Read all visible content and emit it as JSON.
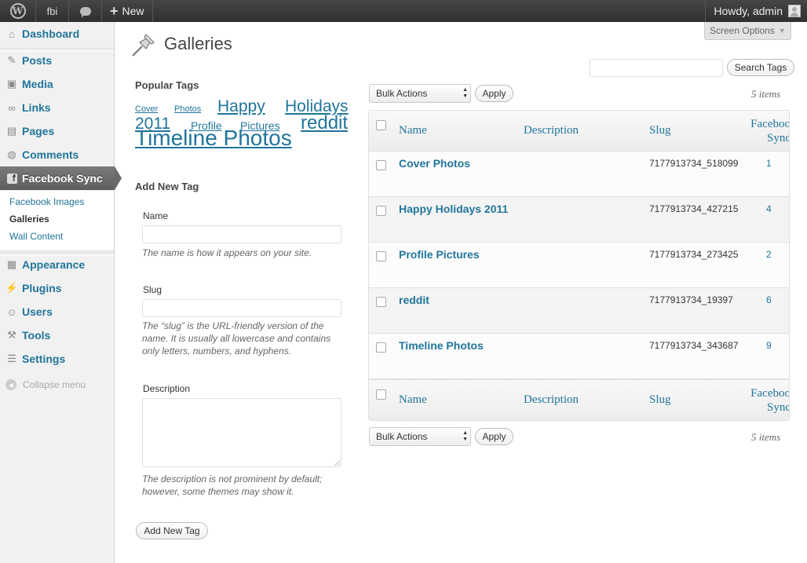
{
  "admin_bar": {
    "site_name": "fbi",
    "new_label": "New",
    "howdy": "Howdy, admin"
  },
  "sidebar": {
    "items": [
      {
        "label": "Dashboard",
        "icon": "home-icon"
      },
      {
        "label": "Posts",
        "icon": "pushpin-icon"
      },
      {
        "label": "Media",
        "icon": "media-icon"
      },
      {
        "label": "Links",
        "icon": "link-icon"
      },
      {
        "label": "Pages",
        "icon": "page-icon"
      },
      {
        "label": "Comments",
        "icon": "comment-icon"
      },
      {
        "label": "Facebook Sync",
        "icon": "facebook-icon"
      },
      {
        "label": "Appearance",
        "icon": "appearance-icon"
      },
      {
        "label": "Plugins",
        "icon": "plugin-icon"
      },
      {
        "label": "Users",
        "icon": "users-icon"
      },
      {
        "label": "Tools",
        "icon": "tools-icon"
      },
      {
        "label": "Settings",
        "icon": "settings-icon"
      }
    ],
    "submenu": [
      "Facebook Images",
      "Galleries",
      "Wall Content"
    ],
    "collapse": "Collapse menu"
  },
  "screen_options": "Screen Options",
  "page": {
    "title": "Galleries",
    "search_button": "Search Tags",
    "search_placeholder": ""
  },
  "popular_tags": {
    "heading": "Popular Tags",
    "tags": [
      "Cover",
      "Photos",
      "Happy",
      "Holidays",
      "2011",
      "Profile",
      "Pictures",
      "reddit",
      "Timeline Photos"
    ]
  },
  "add_tag": {
    "heading": "Add New Tag",
    "name_label": "Name",
    "name_desc": "The name is how it appears on your site.",
    "slug_label": "Slug",
    "slug_desc_1": "The “slug” is the URL-friendly version of the",
    "slug_desc_2": "name. It is usually all lowercase and contains",
    "slug_desc_3": "only letters, numbers, and hyphens.",
    "desc_label": "Description",
    "desc_desc_1": "The description is not prominent by default;",
    "desc_desc_2": "however, some themes may show it.",
    "submit": "Add New Tag"
  },
  "table": {
    "bulk_actions": "Bulk Actions",
    "apply": "Apply",
    "items": "5 items",
    "columns": {
      "name": "Name",
      "description": "Description",
      "slug": "Slug",
      "count_1": "Faceboo",
      "count_2": "Sync"
    },
    "rows": [
      {
        "name": "Cover Photos",
        "slug": "7177913734_518099",
        "count": "1"
      },
      {
        "name": "Happy Holidays 2011",
        "slug": "7177913734_427215",
        "count": "4"
      },
      {
        "name": "Profile Pictures",
        "slug": "7177913734_273425",
        "count": "2"
      },
      {
        "name": "reddit",
        "slug": "7177913734_19397",
        "count": "6"
      },
      {
        "name": "Timeline Photos",
        "slug": "7177913734_343687",
        "count": "9"
      }
    ]
  }
}
